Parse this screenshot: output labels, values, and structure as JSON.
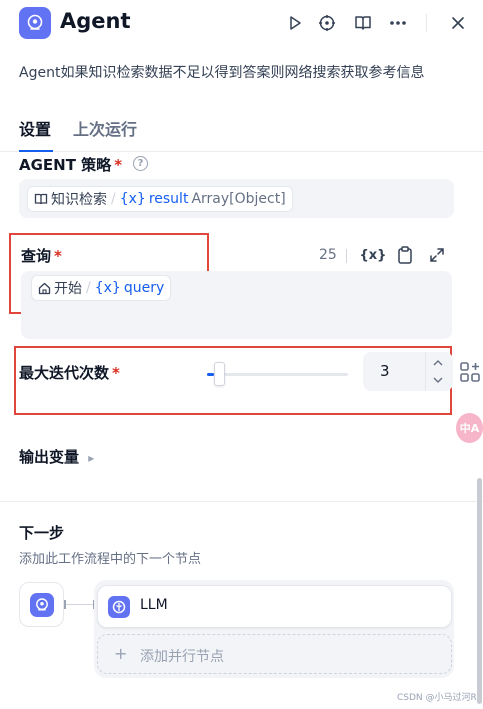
{
  "header": {
    "title": "Agent",
    "description": "Agent如果知识检索数据不足以得到答案则网络搜索获取参考信息",
    "icons": [
      "run-play-icon",
      "locate-crosshair-icon",
      "book-icon",
      "more-icon",
      "close-icon"
    ]
  },
  "tabs": [
    {
      "label": "设置",
      "active": true
    },
    {
      "label": "上次运行",
      "active": false
    }
  ],
  "strategy": {
    "label": "AGENT 策略",
    "required_mark": "*",
    "help_symbol": "?",
    "chip": {
      "node": "知识检索",
      "var_symbol": "{x}",
      "var_name": "result",
      "var_type": "Array[Object]"
    }
  },
  "query": {
    "label": "查询",
    "required_mark": "*",
    "count": "25",
    "var_button": "{x}",
    "chip": {
      "node": "开始",
      "var_symbol": "{x}",
      "var_name": "query"
    }
  },
  "max_iterations": {
    "label": "最大迭代次数",
    "required_mark": "*",
    "value": "3",
    "slider_fraction": 0.05
  },
  "output_vars": {
    "label": "输出变量",
    "arrow": "▸"
  },
  "next_step": {
    "title": "下一步",
    "subtitle": "添加此工作流程中的下一个节点",
    "next_node_label": "LLM",
    "add_parallel_plus": "+",
    "add_parallel_label": "添加并行节点"
  },
  "side_floats": {
    "translate_text": "中A"
  },
  "watermark": "CSDN @小马过河R",
  "colors": {
    "accent": "#155eef",
    "brand_icon": "#6172f3",
    "required": "#d92d20",
    "annotation_box": "#e0463c"
  }
}
